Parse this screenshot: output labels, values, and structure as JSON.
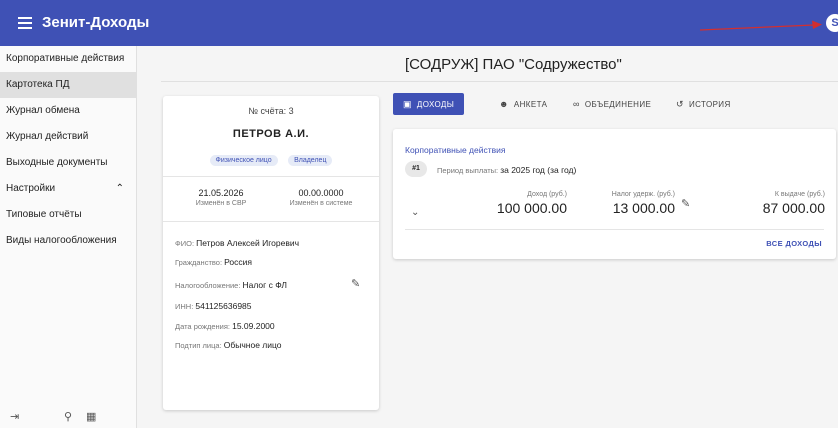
{
  "app": {
    "title": "Зенит-Доходы",
    "avatar_letter": "S",
    "accent": "#3f51b5"
  },
  "sidebar": {
    "items": [
      {
        "label": "Корпоративные действия"
      },
      {
        "label": "Картотека ПД"
      },
      {
        "label": "Журнал обмена"
      },
      {
        "label": "Журнал действий"
      },
      {
        "label": "Выходные документы"
      },
      {
        "label": "Настройки"
      },
      {
        "label": "Типовые отчёты"
      },
      {
        "label": "Виды налогообложения"
      }
    ],
    "active_index": 1,
    "footer_icons": [
      "logout-icon",
      "key-icon",
      "tree-icon"
    ]
  },
  "page": {
    "title": "[СОДРУЖ] ПАО \"Содружество\""
  },
  "person": {
    "account_label": "№ счёта: 3",
    "name": "ПЕТРОВ А.И.",
    "chips": [
      "Физическое лицо",
      "Владелец"
    ],
    "date_sbr": "21.05.2026",
    "date_sbr_label": "Изменён в СВР",
    "date_sys": "00.00.0000",
    "date_sys_label": "Изменён в системе",
    "fields": [
      {
        "k": "ФИО",
        "v": "Петров Алексей Игоревич"
      },
      {
        "k": "Гражданство",
        "v": "Россия"
      },
      {
        "k": "Налогообложение",
        "v": "Налог с ФЛ"
      },
      {
        "k": "ИНН",
        "v": "541125636985"
      },
      {
        "k": "Дата рождения",
        "v": "15.09.2000"
      },
      {
        "k": "Подтип лица",
        "v": "Обычное лицо"
      }
    ]
  },
  "tabs": [
    {
      "label": "ДОХОДЫ",
      "icon": "income-icon"
    },
    {
      "label": "АНКЕТА",
      "icon": "person-icon"
    },
    {
      "label": "ОБЪЕДИНЕНИЕ",
      "icon": "link-icon"
    },
    {
      "label": "ИСТОРИЯ",
      "icon": "history-icon"
    }
  ],
  "income": {
    "section_title": "Корпоративные действия",
    "badge": "#1",
    "period_label": "Период выплаты",
    "period_value": "за 2025 год (за год)",
    "income_label": "Доход (руб.)",
    "income_value": "100 000.00",
    "tax_label": "Налог удерж. (руб.)",
    "tax_value": "13 000.00",
    "payout_label": "К выдаче (руб.)",
    "payout_value": "87 000.00",
    "all_label": "ВСЕ ДОХОДЫ"
  }
}
